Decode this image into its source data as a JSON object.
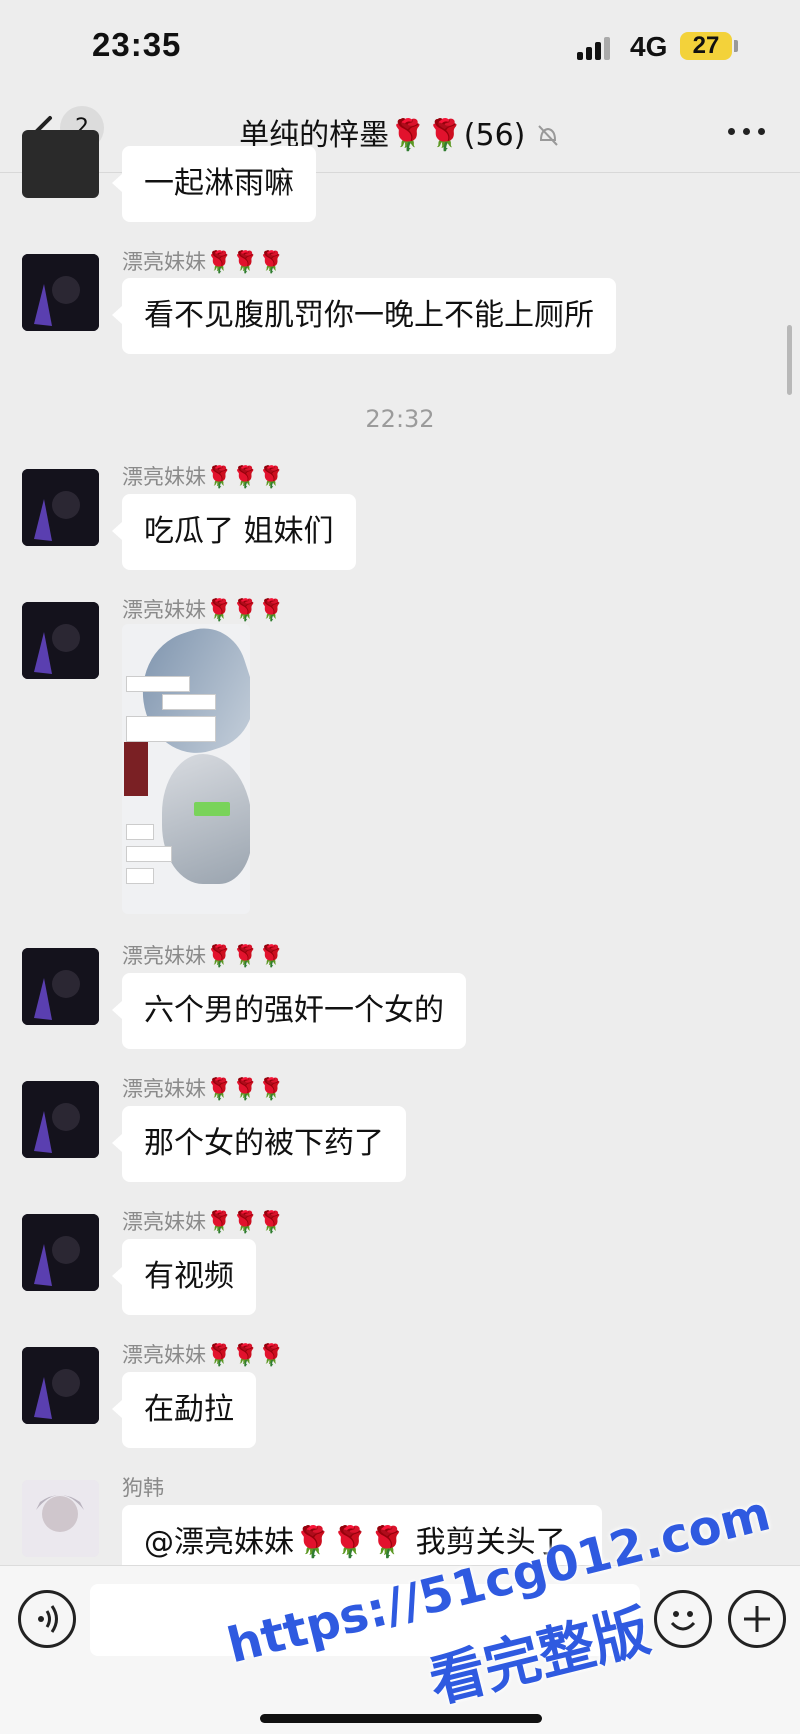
{
  "status_bar": {
    "time": "23:35",
    "network": "4G",
    "battery": "27"
  },
  "nav": {
    "back_count": "2",
    "title": "单纯的梓墨🌹🌹(56)"
  },
  "messages": [
    {
      "type": "text",
      "sender": "",
      "text": "一起淋雨嘛"
    },
    {
      "type": "text",
      "sender": "漂亮妹妹🌹🌹🌹",
      "text": "看不见腹肌罚你一晚上不能上厕所"
    },
    {
      "type": "timestamp",
      "text": "22:32"
    },
    {
      "type": "text",
      "sender": "漂亮妹妹🌹🌹🌹",
      "text": "吃瓜了 姐妹们"
    },
    {
      "type": "image",
      "sender": "漂亮妹妹🌹🌹🌹"
    },
    {
      "type": "text",
      "sender": "漂亮妹妹🌹🌹🌹",
      "text": "六个男的强奸一个女的"
    },
    {
      "type": "text",
      "sender": "漂亮妹妹🌹🌹🌹",
      "text": "那个女的被下药了"
    },
    {
      "type": "text",
      "sender": "漂亮妹妹🌹🌹🌹",
      "text": "有视频"
    },
    {
      "type": "text",
      "sender": "漂亮妹妹🌹🌹🌹",
      "text": "在勐拉"
    },
    {
      "type": "text",
      "sender": "狗韩",
      "text": "@漂亮妹妹🌹🌹🌹 我剪关头了"
    }
  ],
  "watermark": {
    "line1": "https://51cg012.com",
    "line2": "看完整版"
  },
  "input": {
    "placeholder": ""
  },
  "colors": {
    "background": "#ededed",
    "bubble": "#ffffff",
    "watermark": "#2f5ae0"
  }
}
